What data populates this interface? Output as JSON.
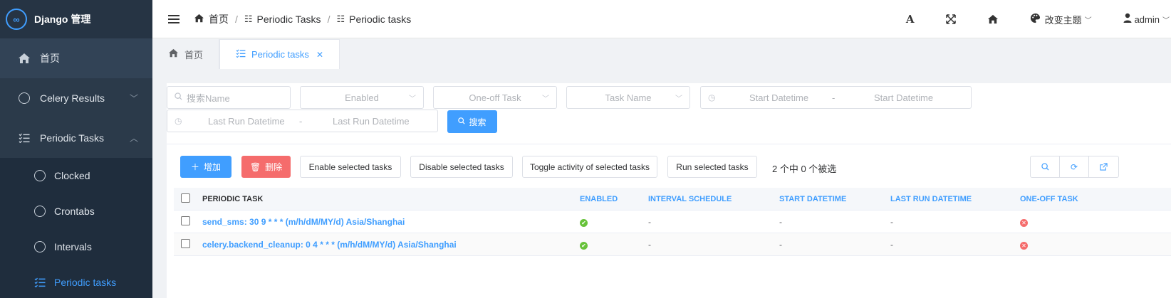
{
  "brand": {
    "title": "Django 管理",
    "logo_text": "∞"
  },
  "sidebar": {
    "items": [
      {
        "label": "首页",
        "icon": "home-icon"
      },
      {
        "label": "Celery Results",
        "icon": "circle-icon",
        "arrow": "﹀"
      },
      {
        "label": "Periodic Tasks",
        "icon": "task-list-icon",
        "arrow": "︿"
      }
    ],
    "subitems": [
      {
        "label": "Clocked",
        "icon": "circle-icon"
      },
      {
        "label": "Crontabs",
        "icon": "circle-icon"
      },
      {
        "label": "Intervals",
        "icon": "circle-icon"
      },
      {
        "label": "Periodic tasks",
        "icon": "task-list-icon",
        "active": true
      }
    ]
  },
  "header": {
    "breadcrumb": [
      "首页",
      "Periodic Tasks",
      "Periodic tasks"
    ],
    "font_btn": "A",
    "theme_label": "改变主题",
    "user_label": "admin"
  },
  "tabs": [
    {
      "label": "首页",
      "icon": "home-icon"
    },
    {
      "label": "Periodic tasks",
      "icon": "task-list-icon",
      "closable": true,
      "active": true
    }
  ],
  "filters": {
    "search_placeholder": "搜索Name",
    "enabled_placeholder": "Enabled",
    "oneoff_placeholder": "One-off Task",
    "taskname_placeholder": "Task Name",
    "start_from": "Start Datetime",
    "start_to": "Start Datetime",
    "lastrun_from": "Last Run Datetime",
    "lastrun_to": "Last Run Datetime",
    "range_sep": "-",
    "search_button": "搜索"
  },
  "actions": {
    "add": "增加",
    "delete": "删除",
    "enable": "Enable selected tasks",
    "disable": "Disable selected tasks",
    "toggle": "Toggle activity of selected tasks",
    "run": "Run selected tasks",
    "selection_info": "2 个中 0 个被选"
  },
  "table": {
    "columns": [
      "PERIODIC TASK",
      "ENABLED",
      "INTERVAL SCHEDULE",
      "START DATETIME",
      "LAST RUN DATETIME",
      "ONE-OFF TASK"
    ],
    "rows": [
      {
        "task": "send_sms: 30 9 * * * (m/h/dM/MY/d) Asia/Shanghai",
        "enabled": true,
        "interval": "-",
        "start": "-",
        "last_run": "-",
        "one_off": false
      },
      {
        "task": "celery.backend_cleanup: 0 4 * * * (m/h/dM/MY/d) Asia/Shanghai",
        "enabled": true,
        "interval": "-",
        "start": "-",
        "last_run": "-",
        "one_off": false
      }
    ]
  },
  "colors": {
    "primary": "#409eff",
    "danger": "#f56c6c",
    "success": "#67c23a",
    "sidebar_bg": "#2b3a4a"
  }
}
